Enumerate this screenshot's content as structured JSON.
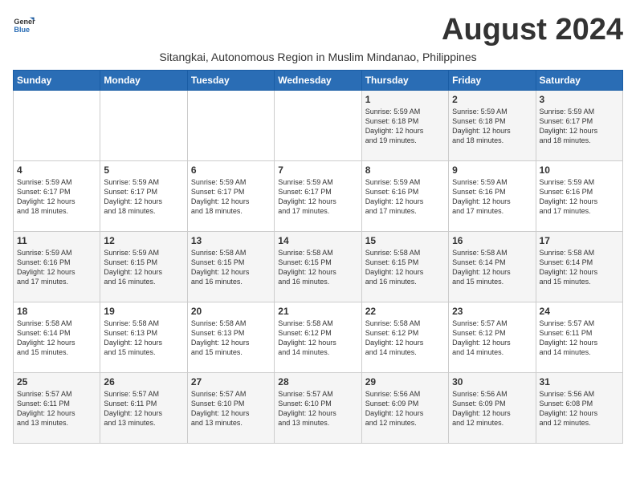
{
  "logo": {
    "line1": "General",
    "line2": "Blue"
  },
  "title": "August 2024",
  "subtitle": "Sitangkai, Autonomous Region in Muslim Mindanao, Philippines",
  "weekdays": [
    "Sunday",
    "Monday",
    "Tuesday",
    "Wednesday",
    "Thursday",
    "Friday",
    "Saturday"
  ],
  "weeks": [
    [
      {
        "day": "",
        "info": ""
      },
      {
        "day": "",
        "info": ""
      },
      {
        "day": "",
        "info": ""
      },
      {
        "day": "",
        "info": ""
      },
      {
        "day": "1",
        "info": "Sunrise: 5:59 AM\nSunset: 6:18 PM\nDaylight: 12 hours\nand 19 minutes."
      },
      {
        "day": "2",
        "info": "Sunrise: 5:59 AM\nSunset: 6:18 PM\nDaylight: 12 hours\nand 18 minutes."
      },
      {
        "day": "3",
        "info": "Sunrise: 5:59 AM\nSunset: 6:17 PM\nDaylight: 12 hours\nand 18 minutes."
      }
    ],
    [
      {
        "day": "4",
        "info": "Sunrise: 5:59 AM\nSunset: 6:17 PM\nDaylight: 12 hours\nand 18 minutes."
      },
      {
        "day": "5",
        "info": "Sunrise: 5:59 AM\nSunset: 6:17 PM\nDaylight: 12 hours\nand 18 minutes."
      },
      {
        "day": "6",
        "info": "Sunrise: 5:59 AM\nSunset: 6:17 PM\nDaylight: 12 hours\nand 18 minutes."
      },
      {
        "day": "7",
        "info": "Sunrise: 5:59 AM\nSunset: 6:17 PM\nDaylight: 12 hours\nand 17 minutes."
      },
      {
        "day": "8",
        "info": "Sunrise: 5:59 AM\nSunset: 6:16 PM\nDaylight: 12 hours\nand 17 minutes."
      },
      {
        "day": "9",
        "info": "Sunrise: 5:59 AM\nSunset: 6:16 PM\nDaylight: 12 hours\nand 17 minutes."
      },
      {
        "day": "10",
        "info": "Sunrise: 5:59 AM\nSunset: 6:16 PM\nDaylight: 12 hours\nand 17 minutes."
      }
    ],
    [
      {
        "day": "11",
        "info": "Sunrise: 5:59 AM\nSunset: 6:16 PM\nDaylight: 12 hours\nand 17 minutes."
      },
      {
        "day": "12",
        "info": "Sunrise: 5:59 AM\nSunset: 6:15 PM\nDaylight: 12 hours\nand 16 minutes."
      },
      {
        "day": "13",
        "info": "Sunrise: 5:58 AM\nSunset: 6:15 PM\nDaylight: 12 hours\nand 16 minutes."
      },
      {
        "day": "14",
        "info": "Sunrise: 5:58 AM\nSunset: 6:15 PM\nDaylight: 12 hours\nand 16 minutes."
      },
      {
        "day": "15",
        "info": "Sunrise: 5:58 AM\nSunset: 6:15 PM\nDaylight: 12 hours\nand 16 minutes."
      },
      {
        "day": "16",
        "info": "Sunrise: 5:58 AM\nSunset: 6:14 PM\nDaylight: 12 hours\nand 15 minutes."
      },
      {
        "day": "17",
        "info": "Sunrise: 5:58 AM\nSunset: 6:14 PM\nDaylight: 12 hours\nand 15 minutes."
      }
    ],
    [
      {
        "day": "18",
        "info": "Sunrise: 5:58 AM\nSunset: 6:14 PM\nDaylight: 12 hours\nand 15 minutes."
      },
      {
        "day": "19",
        "info": "Sunrise: 5:58 AM\nSunset: 6:13 PM\nDaylight: 12 hours\nand 15 minutes."
      },
      {
        "day": "20",
        "info": "Sunrise: 5:58 AM\nSunset: 6:13 PM\nDaylight: 12 hours\nand 15 minutes."
      },
      {
        "day": "21",
        "info": "Sunrise: 5:58 AM\nSunset: 6:12 PM\nDaylight: 12 hours\nand 14 minutes."
      },
      {
        "day": "22",
        "info": "Sunrise: 5:58 AM\nSunset: 6:12 PM\nDaylight: 12 hours\nand 14 minutes."
      },
      {
        "day": "23",
        "info": "Sunrise: 5:57 AM\nSunset: 6:12 PM\nDaylight: 12 hours\nand 14 minutes."
      },
      {
        "day": "24",
        "info": "Sunrise: 5:57 AM\nSunset: 6:11 PM\nDaylight: 12 hours\nand 14 minutes."
      }
    ],
    [
      {
        "day": "25",
        "info": "Sunrise: 5:57 AM\nSunset: 6:11 PM\nDaylight: 12 hours\nand 13 minutes."
      },
      {
        "day": "26",
        "info": "Sunrise: 5:57 AM\nSunset: 6:11 PM\nDaylight: 12 hours\nand 13 minutes."
      },
      {
        "day": "27",
        "info": "Sunrise: 5:57 AM\nSunset: 6:10 PM\nDaylight: 12 hours\nand 13 minutes."
      },
      {
        "day": "28",
        "info": "Sunrise: 5:57 AM\nSunset: 6:10 PM\nDaylight: 12 hours\nand 13 minutes."
      },
      {
        "day": "29",
        "info": "Sunrise: 5:56 AM\nSunset: 6:09 PM\nDaylight: 12 hours\nand 12 minutes."
      },
      {
        "day": "30",
        "info": "Sunrise: 5:56 AM\nSunset: 6:09 PM\nDaylight: 12 hours\nand 12 minutes."
      },
      {
        "day": "31",
        "info": "Sunrise: 5:56 AM\nSunset: 6:08 PM\nDaylight: 12 hours\nand 12 minutes."
      }
    ]
  ]
}
